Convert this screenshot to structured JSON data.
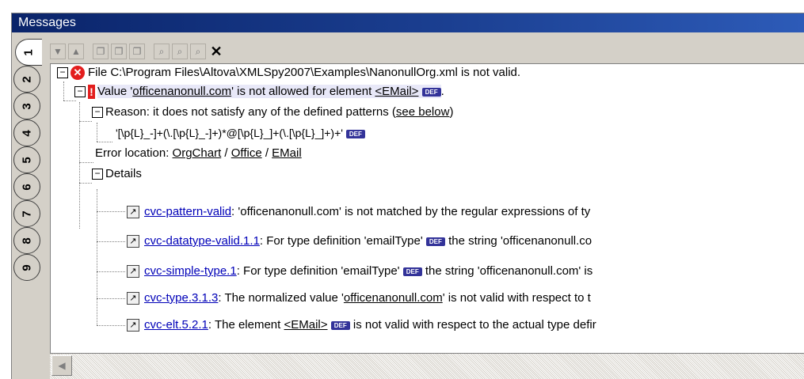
{
  "window": {
    "title": "Messages"
  },
  "tabs": [
    "1",
    "2",
    "3",
    "4",
    "5",
    "6",
    "7",
    "8",
    "9"
  ],
  "toolbar": {
    "buttons": [
      {
        "name": "next-message",
        "glyph": "▼"
      },
      {
        "name": "previous-message",
        "glyph": "▲"
      },
      {
        "name": "copy-message",
        "glyph": "❐"
      },
      {
        "name": "copy-branch",
        "glyph": "❐"
      },
      {
        "name": "copy-all",
        "glyph": "❐"
      },
      {
        "name": "find",
        "glyph": "⌕"
      },
      {
        "name": "find-previous",
        "glyph": "⌕"
      },
      {
        "name": "find-next",
        "glyph": "⌕"
      },
      {
        "name": "clear",
        "glyph": "✕"
      }
    ]
  },
  "messages": {
    "root": {
      "text": "File C:\\Program Files\\Altova\\XMLSpy2007\\Examples\\NanonullOrg.xml is not valid."
    },
    "value_prefix": "Value '",
    "value_link": "officenanonull.com",
    "value_mid": "' is not allowed for element ",
    "value_element": "<EMail>",
    "value_end": ".",
    "reason_prefix": "Reason: it does not satisfy any of the defined patterns (",
    "reason_link": "see below",
    "reason_end": ")",
    "pattern": "'[\\p{L}_-]+(\\.[\\p{L}_-]+)*@[\\p{L}_]+(\\.[\\p{L}_]+)+'",
    "errloc_prefix": "Error location: ",
    "errloc_path": [
      "OrgChart",
      "Office",
      "EMail"
    ],
    "errloc_sep": " / ",
    "details_label": "Details",
    "def_badge": "DEF",
    "details": [
      {
        "link": "cvc-pattern-valid",
        "pre": ": 'officenanonull.com' is not matched by the regular expressions of ty",
        "mid": "",
        "post": ""
      },
      {
        "link": "cvc-datatype-valid.1.1",
        "pre": ": For type definition 'emailType' ",
        "mid": "",
        "post": " the string 'officenanonull.co"
      },
      {
        "link": "cvc-simple-type.1",
        "pre": ": For type definition 'emailType' ",
        "mid": "",
        "post": " the string 'officenanonull.com' is"
      },
      {
        "link": "cvc-type.3.1.3",
        "pre": ": The normalized value '",
        "mid": "officenanonull.com",
        "post": "' is not valid with respect to t"
      },
      {
        "link": "cvc-elt.5.2.1",
        "pre": ": The element ",
        "mid": "<EMail>",
        "post": " is not valid with respect to the actual type defir"
      }
    ]
  },
  "scrollbar": {
    "left_arrow": "◀"
  }
}
